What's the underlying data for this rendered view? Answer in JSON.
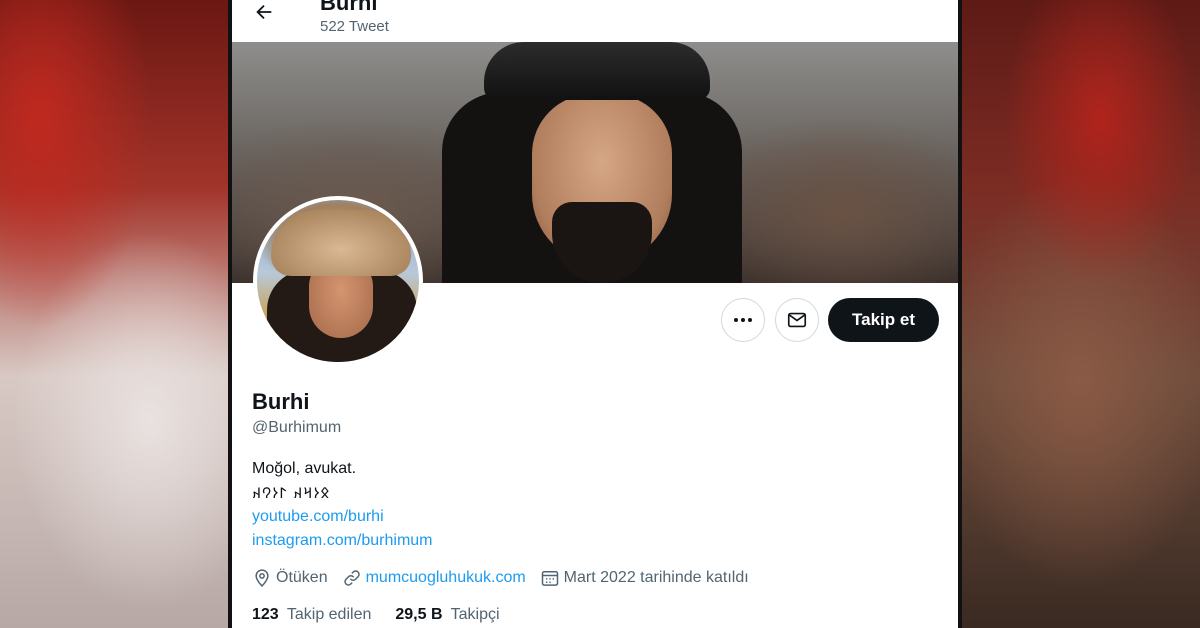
{
  "header": {
    "name": "Burhi",
    "tweet_count": "522 Tweet"
  },
  "profile": {
    "display_name": "Burhi",
    "handle": "@Burhimum",
    "bio_line1": "Moğol, avukat.",
    "bio_line2": "𐰋𐰆𐰺𐰴 𐰃𐰆𐰘𐰴",
    "link1": "youtube.com/burhi",
    "link2": "instagram.com/burhimum",
    "location": "Ötüken",
    "website": "mumcuogluhukuk.com",
    "joined": "Mart 2022 tarihinde katıldı",
    "following_count": "123",
    "following_label": "Takip edilen",
    "followers_count": "29,5 B",
    "followers_label": "Takipçi"
  },
  "actions": {
    "follow_label": "Takip et",
    "more_icon": "more-icon",
    "message_icon": "mail-icon"
  },
  "colors": {
    "link": "#1d9bf0",
    "text": "#0f1419",
    "secondary": "#536471",
    "button_dark": "#0f1419"
  }
}
